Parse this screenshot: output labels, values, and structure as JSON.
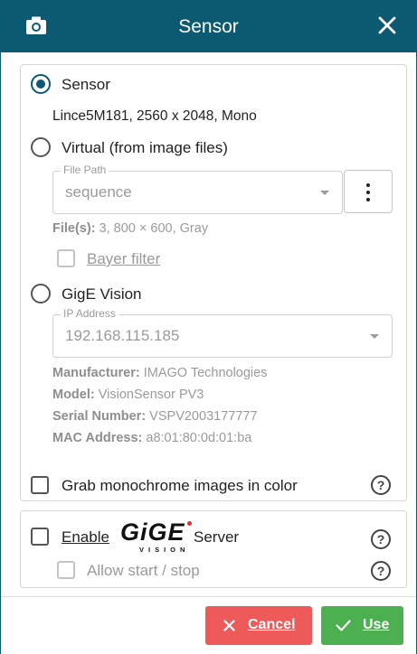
{
  "header": {
    "title": "Sensor",
    "accent": "#0b5a72",
    "left_icon": "camera-icon",
    "right_icon": "close-icon"
  },
  "source": {
    "sensor_label": "Sensor",
    "sensor_desc": "Lince5M181, 2560 x 2048, Mono",
    "virtual_label": "Virtual (from image files)",
    "file_path": {
      "legend": "File Path",
      "value": "sequence"
    },
    "files_info": {
      "label": "File(s):",
      "value": " 3, 800 × 600, Gray"
    },
    "bayer_label": "Bayer filter",
    "gige_label": "GigE Vision",
    "ip": {
      "legend": "IP Address",
      "value": "192.168.115.185"
    },
    "gige_info": [
      {
        "label": "Manufacturer:",
        "value": " IMAGO Technologies"
      },
      {
        "label": "Model:",
        "value": " VisionSensor PV3"
      },
      {
        "label": "Serial Number:",
        "value": " VSPV2003177777"
      },
      {
        "label": "MAC Address:",
        "value": " a8:01:80:0d:01:ba"
      }
    ],
    "grab_mono_label": "Grab monochrome images in color",
    "selected": "Sensor"
  },
  "server": {
    "enable_label": "Enable",
    "gige_logo": {
      "big": "GiGE",
      "small": "VISION"
    },
    "server_label": "Server",
    "allow_label": "Allow start / stop"
  },
  "footer": {
    "cancel_label": "Cancel",
    "use_label": "Use",
    "cancel_color": "#ee5a5a",
    "use_color": "#4caf50"
  }
}
